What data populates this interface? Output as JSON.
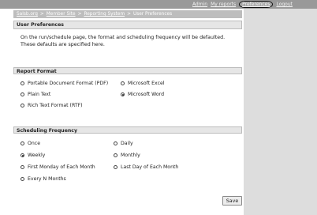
{
  "topbar": {
    "links": [
      {
        "label": "Admin"
      },
      {
        "label": "My reports"
      },
      {
        "label": "Preferences"
      },
      {
        "label": "Logout"
      }
    ]
  },
  "breadcrumb": {
    "items": [
      "Salsb.org",
      "Member Site",
      "Reporting System",
      "User Preferences"
    ]
  },
  "user_preferences": {
    "title": "User Preferences",
    "description": "On the run/schedule page, the format and scheduling frequency will be defaulted. These defaults are specified here."
  },
  "report_format": {
    "title": "Report Format",
    "options": [
      {
        "label": "Portable Document Format (PDF)",
        "selected": false
      },
      {
        "label": "Microsoft Excel",
        "selected": false
      },
      {
        "label": "Plain Text",
        "selected": false
      },
      {
        "label": "Microsoft Word",
        "selected": true
      },
      {
        "label": "Rich Text Format (RTF)",
        "selected": false
      }
    ]
  },
  "scheduling_frequency": {
    "title": "Scheduling Frequency",
    "options": [
      {
        "label": "Once",
        "selected": false
      },
      {
        "label": "Daily",
        "selected": false
      },
      {
        "label": "Weekly",
        "selected": true
      },
      {
        "label": "Monthly",
        "selected": false
      },
      {
        "label": "First Monday of Each Month",
        "selected": false
      },
      {
        "label": "Last Day of Each Month",
        "selected": false
      },
      {
        "label": "Every N Months",
        "selected": false
      }
    ]
  },
  "save_label": "Save"
}
